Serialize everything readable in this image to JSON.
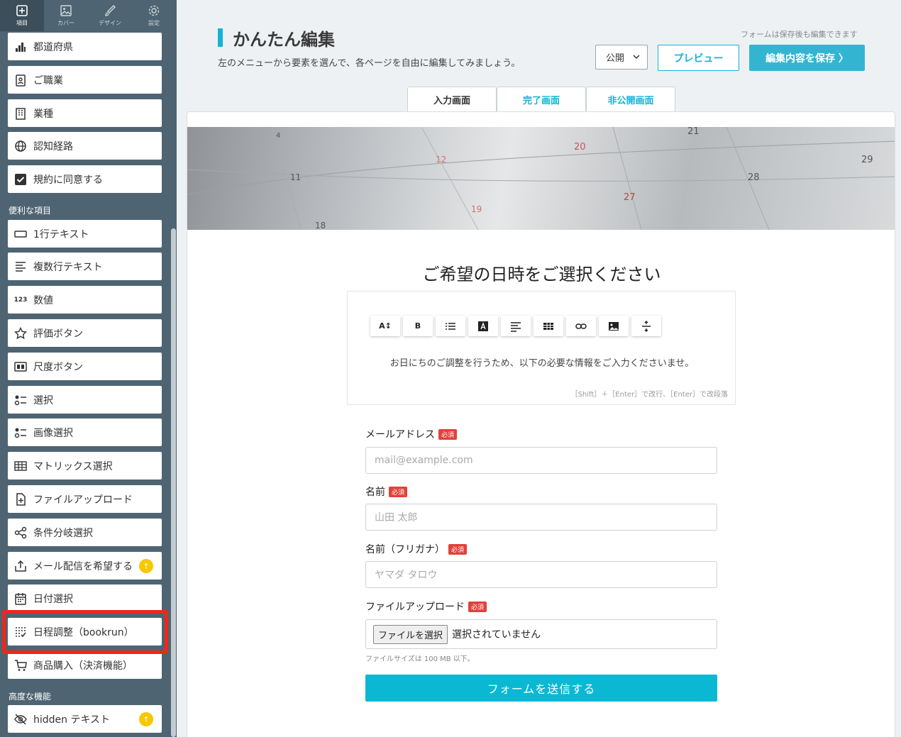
{
  "sidebar": {
    "tabs": [
      {
        "label": "項目",
        "icon": "plus-square-icon"
      },
      {
        "label": "カバー",
        "icon": "image-icon"
      },
      {
        "label": "デザイン",
        "icon": "brush-icon"
      },
      {
        "label": "設定",
        "icon": "gear-icon"
      }
    ],
    "items_top": [
      {
        "label": "都道府県",
        "icon": "map-icon"
      },
      {
        "label": "ご職業",
        "icon": "id-badge-icon"
      },
      {
        "label": "業種",
        "icon": "building-icon"
      },
      {
        "label": "認知経路",
        "icon": "globe-icon"
      },
      {
        "label": "規約に同意する",
        "icon": "checkbox-icon"
      }
    ],
    "section_useful": "便利な項目",
    "items_useful": [
      {
        "label": "1行テキスト",
        "icon": "single-line-icon"
      },
      {
        "label": "複数行テキスト",
        "icon": "multi-line-icon"
      },
      {
        "label": "数値",
        "icon": "number-icon",
        "glyph": "123"
      },
      {
        "label": "評価ボタン",
        "icon": "star-icon"
      },
      {
        "label": "尺度ボタン",
        "icon": "scale-icon"
      },
      {
        "label": "選択",
        "icon": "list-select-icon"
      },
      {
        "label": "画像選択",
        "icon": "image-select-icon"
      },
      {
        "label": "マトリックス選択",
        "icon": "table-icon"
      },
      {
        "label": "ファイルアップロード",
        "icon": "file-plus-icon"
      },
      {
        "label": "条件分岐選択",
        "icon": "share-icon"
      },
      {
        "label": "メール配信を希望する",
        "icon": "inbox-upload-icon",
        "badge": "↑"
      },
      {
        "label": "日付選択",
        "icon": "calendar-icon"
      },
      {
        "label": "日程調整（bookrun）",
        "icon": "schedule-check-icon"
      },
      {
        "label": "商品購入（決済機能）",
        "icon": "cart-icon"
      }
    ],
    "section_advanced": "高度な機能",
    "items_advanced": [
      {
        "label": "hidden テキスト",
        "icon": "eye-off-icon",
        "badge": "↑"
      }
    ]
  },
  "header": {
    "title": "かんたん編集",
    "subtitle": "左のメニューから要素を選んで、各ページを自由に編集してみましょう。",
    "note": "フォームは保存後も編集できます",
    "status_select": "公開",
    "preview_label": "プレビュー",
    "save_label": "編集内容を保存 〉"
  },
  "tabs": [
    "入力画面",
    "完了画面",
    "非公開画面"
  ],
  "hero": {
    "numbers": [
      "4",
      "11",
      "12",
      "18",
      "19",
      "20",
      "21",
      "27",
      "28",
      "29"
    ]
  },
  "form": {
    "heading": "ご希望の日時をご選択ください",
    "editor_text": "お日にちのご調整を行うため、以下の必要な情報をご入力くださいませ。",
    "editor_hint": "［Shift］＋［Enter］で改行、［Enter］で改段落",
    "toolbar": [
      "A↕",
      "B",
      "list",
      "A",
      "align",
      "table",
      "link",
      "image",
      "spacing"
    ],
    "required_badge": "必須",
    "fields": [
      {
        "label": "メールアドレス",
        "placeholder": "mail@example.com"
      },
      {
        "label": "名前",
        "placeholder": "山田 太郎"
      },
      {
        "label": "名前（フリガナ）",
        "placeholder": "ヤマダ タロウ"
      }
    ],
    "file_label": "ファイルアップロード",
    "file_button": "ファイルを選択",
    "file_status": "選択されていません",
    "file_note": "ファイルサイズは 100 MB 以下。",
    "submit": "フォームを送信する"
  }
}
